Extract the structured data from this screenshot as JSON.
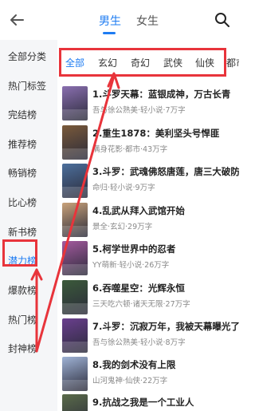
{
  "header": {
    "tabs": [
      {
        "label": "男生",
        "active": true
      },
      {
        "label": "女生",
        "active": false
      }
    ],
    "back_icon": "back-arrow-icon",
    "search_icon": "search-icon"
  },
  "sidebar": {
    "items": [
      {
        "label": "全部分类"
      },
      {
        "label": "热门标签"
      },
      {
        "label": "完结榜"
      },
      {
        "label": "推荐榜"
      },
      {
        "label": "畅销榜"
      },
      {
        "label": "比心榜"
      },
      {
        "label": "新书榜"
      },
      {
        "label": "潜力榜",
        "active": true
      },
      {
        "label": "爆款榜"
      },
      {
        "label": "热门榜"
      },
      {
        "label": "封神榜"
      }
    ]
  },
  "filters": [
    "全部",
    "玄幻",
    "奇幻",
    "武侠",
    "仙侠",
    "都市"
  ],
  "books": [
    {
      "title": "1.斗罗天幕：蓝银成神，万古长青",
      "meta": "吾与徐公熟美·轻小说·7万字",
      "cover": "#8a6fb0"
    },
    {
      "title": "2.重生1878：美利坚头号悍匪",
      "meta": "满身花影·都市·43万字",
      "cover": "#7a5a3a"
    },
    {
      "title": "3.斗罗：武魂佛怒唐莲，唐三大破防",
      "meta": "命归·轻小说·9万字",
      "cover": "#4c6f9c"
    },
    {
      "title": "4.乱武从拜入武馆开始",
      "meta": "景全·玄幻·29万字",
      "cover": "#c9a27a"
    },
    {
      "title": "5.柯学世界中的忍者",
      "meta": "YY萌新·轻小说·26万字",
      "cover": "#a45a9e"
    },
    {
      "title": "6.吞噬星空：光辉永恒",
      "meta": "三天吃六顿·诸天无限·27万字",
      "cover": "#3b5a3a"
    },
    {
      "title": "7.斗罗：沉寂万年，我被天幕曝光了",
      "meta": "吾与徐公熟美·轻小说·8万字",
      "cover": "#6a3f8e"
    },
    {
      "title": "8.我的剑术没有上限",
      "meta": "山河鬼神·仙侠·22万字",
      "cover": "#9fb3d6"
    },
    {
      "title": "9.抗战之我是一个工业人",
      "meta": "",
      "cover": "#5a6b4a"
    }
  ]
}
